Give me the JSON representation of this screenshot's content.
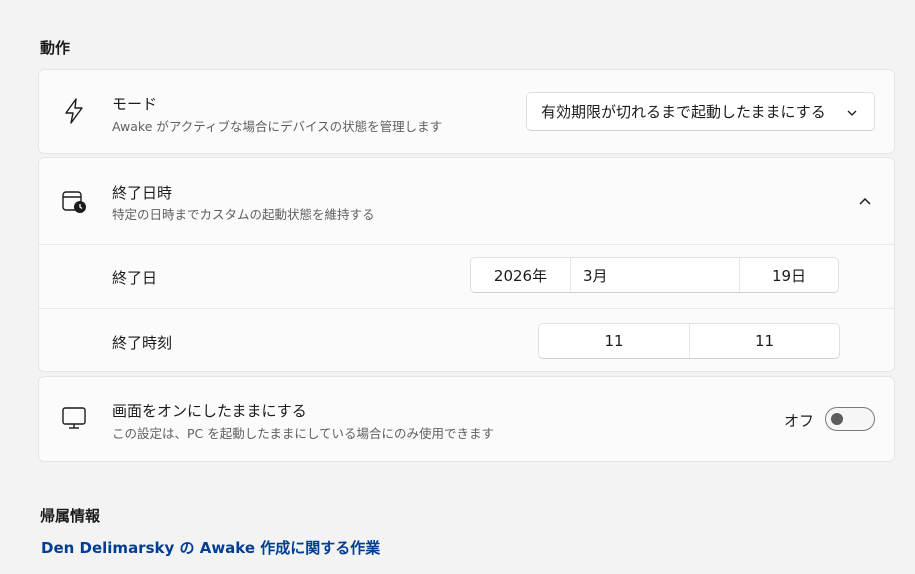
{
  "section_behavior": {
    "title": "動作"
  },
  "mode": {
    "title": "モード",
    "description": "Awake がアクティブな場合にデバイスの状態を管理します",
    "dropdown_value": "有効期限が切れるまで起動したままにする",
    "icon": "lightning-icon"
  },
  "expiration": {
    "title": "終了日時",
    "description": "特定の日時までカスタムの起動状態を維持する",
    "icon": "calendar-clock-icon",
    "end_date": {
      "label": "終了日",
      "year": "2026年",
      "month": "3月",
      "day": "19日"
    },
    "end_time": {
      "label": "終了時刻",
      "hour": "11",
      "minute": "11"
    }
  },
  "keep_screen_on": {
    "title": "画面をオンにしたままにする",
    "description": "この設定は、PC を起動したままにしている場合にのみ使用できます",
    "toggle_label": "オフ",
    "toggle_on": false,
    "icon": "monitor-icon"
  },
  "section_attribution": {
    "title": "帰属情報"
  },
  "attribution_link": {
    "text": "Den Delimarsky の Awake 作成に関する作業"
  },
  "colors": {
    "accent_link": "#003e92",
    "background": "#f3f3f3",
    "card": "#fbfbfb"
  }
}
